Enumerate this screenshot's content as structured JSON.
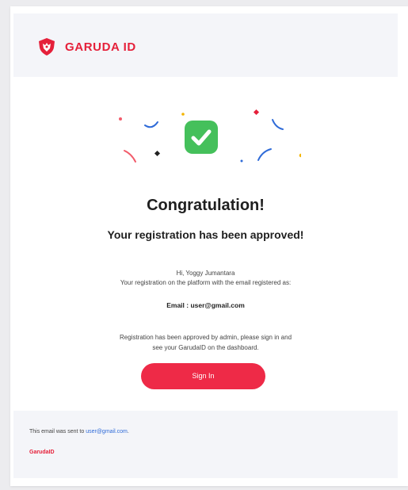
{
  "brand": {
    "name": "GARUDA ID",
    "color": "#e5203a",
    "logo_icon": "garuda-shield-icon"
  },
  "hero": {
    "illustration_icon": "checkmark-confetti-icon",
    "check_color": "#45c05b"
  },
  "content": {
    "title": "Congratulation!",
    "subtitle": "Your registration has been approved!",
    "greeting": "Hi, Yoggy Jumantara",
    "intro": "Your registration on the platform with the email registered as:",
    "email_label": "Email :",
    "email_value": "user@gmail.com",
    "approval_line1": "Registration has been approved by admin, please sign in and",
    "approval_line2": "see your GarudaID on the dashboard.",
    "button_label": "Sign In",
    "button_color": "#ee2a47"
  },
  "footer": {
    "sent_prefix": "This email was sent to ",
    "sent_email": "user@gmail.com",
    "sent_suffix": ".",
    "brand": "GarudaID"
  }
}
